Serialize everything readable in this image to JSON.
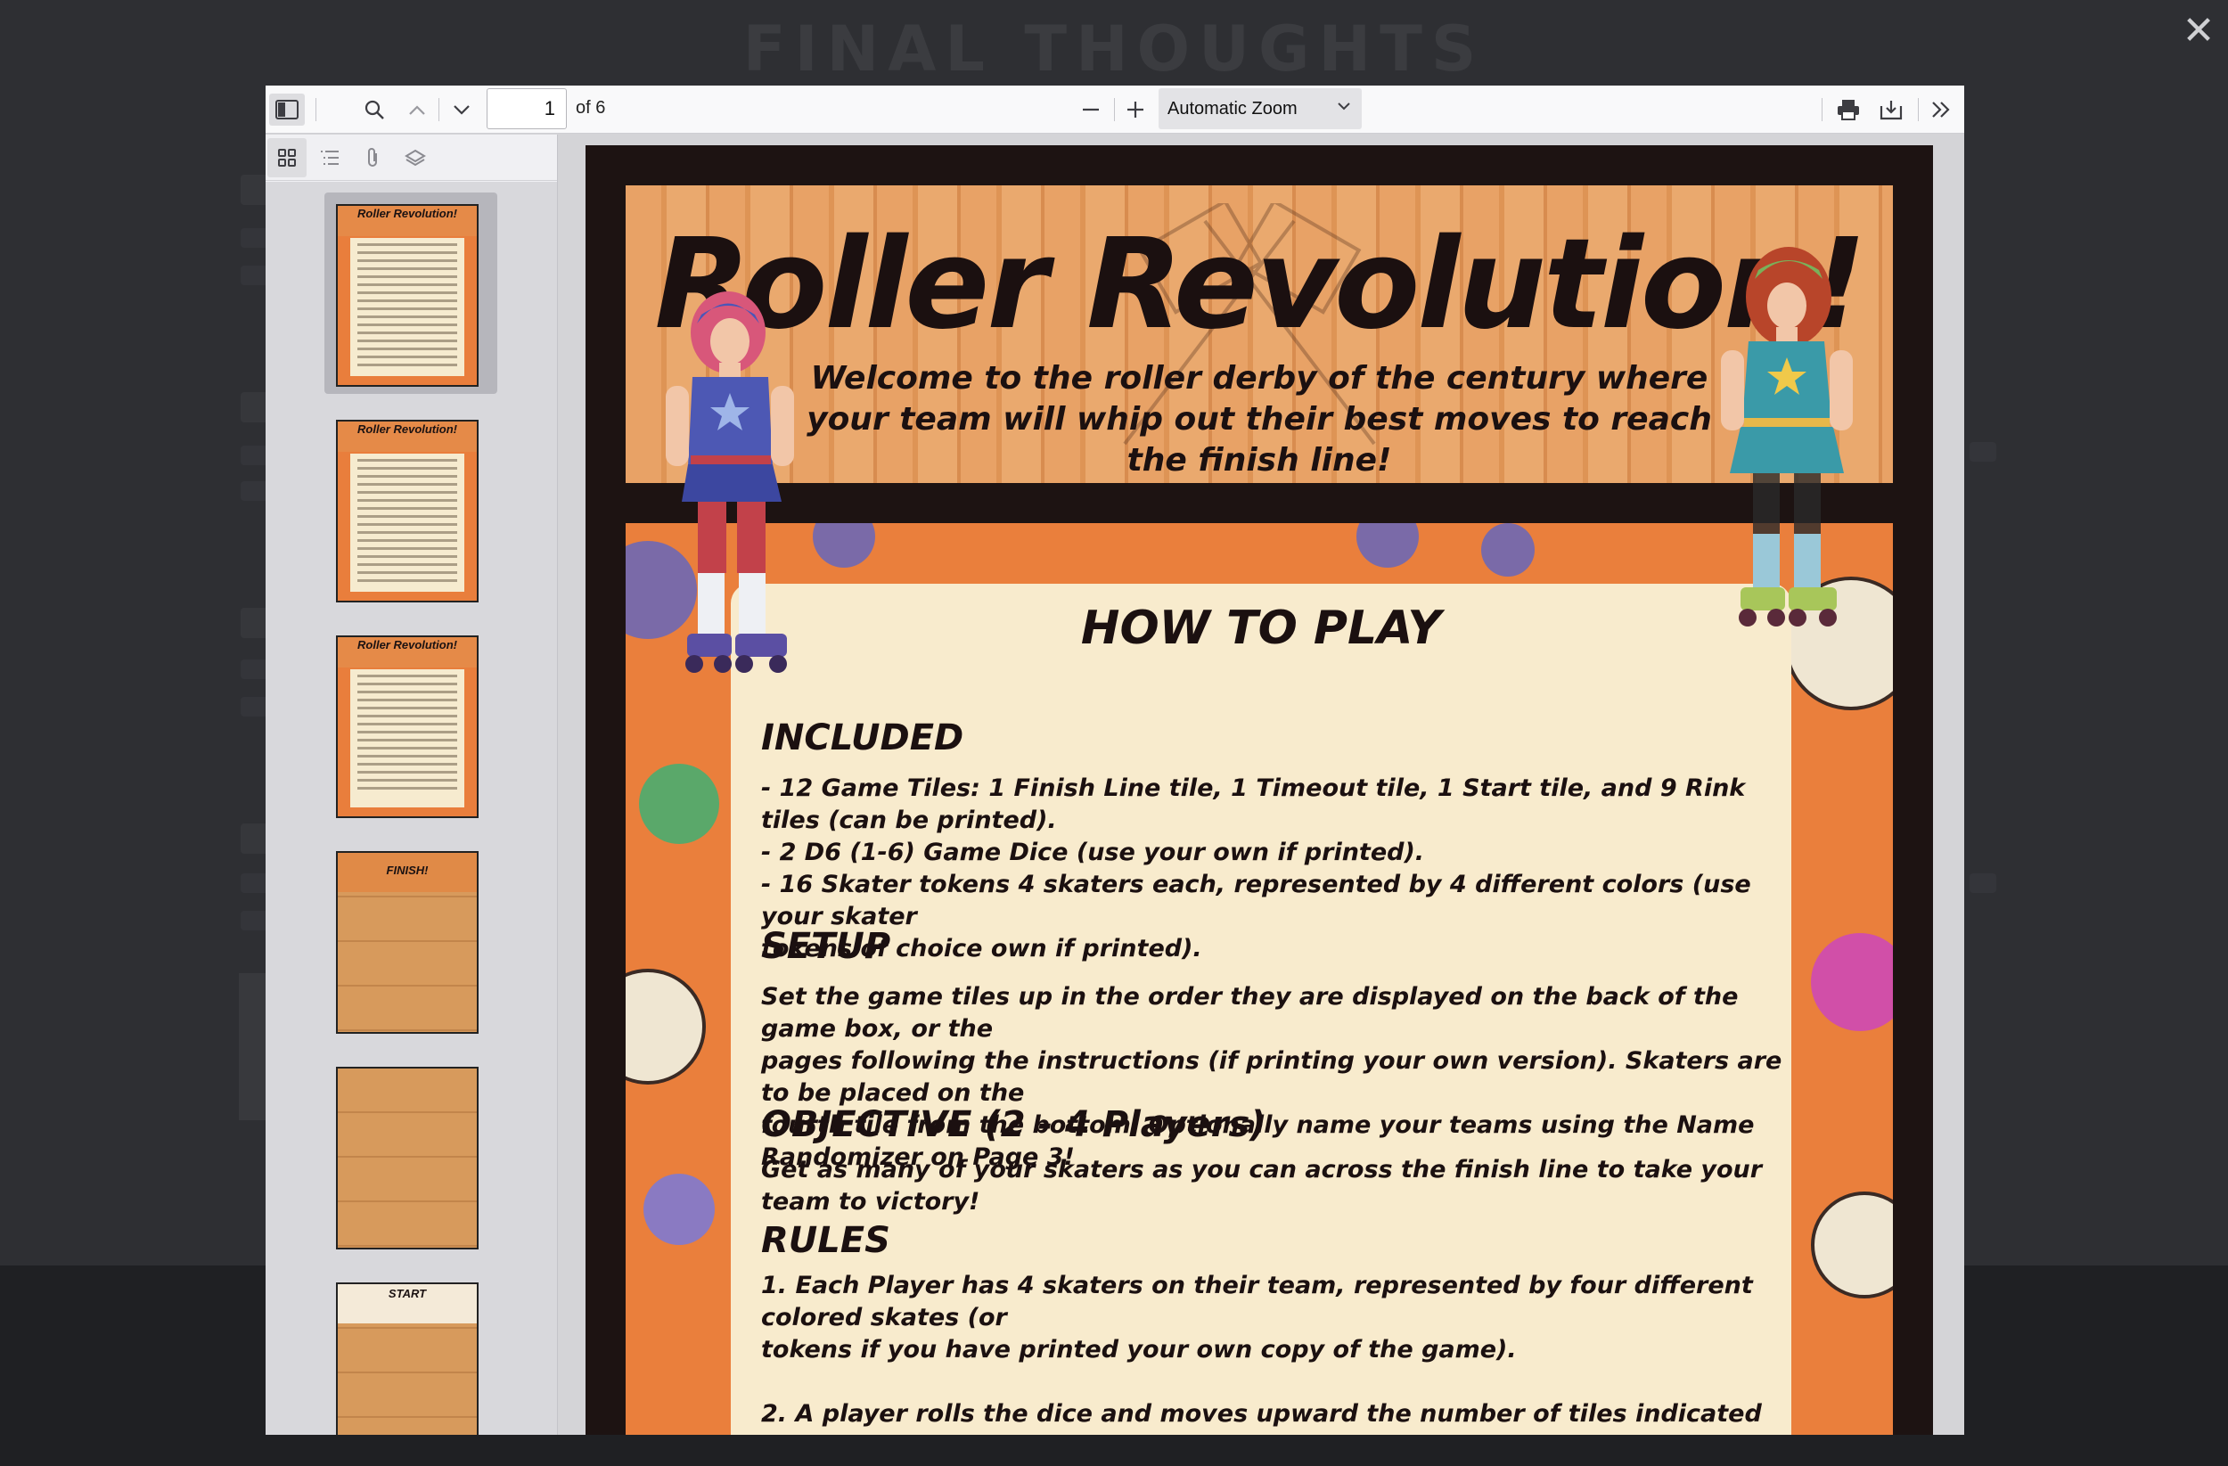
{
  "background": {
    "heading": "FINAL THOUGHTS"
  },
  "toolbar": {
    "page_number": "1",
    "page_count": "of 6",
    "zoom": "Automatic Zoom"
  },
  "document": {
    "title": "Roller Revolution!",
    "subtitle": "Welcome to the roller derby of the century where your team will whip out their best moves to reach the finish line!",
    "section_title": "HOW TO PLAY",
    "included_heading": "INCLUDED",
    "included_text": "- 12 Game Tiles: 1 Finish Line tile, 1 Timeout tile, 1 Start tile, and 9 Rink tiles (can be printed).\n- 2 D6 (1-6) Game Dice (use your own if printed).\n- 16 Skater tokens 4 skaters each, represented by 4 different colors (use your skater\n   tokens of choice own if printed).",
    "setup_heading": "SETUP",
    "setup_text": "Set the game tiles up in the order they are displayed on the back of the game box, or the\npages following the instructions (if printing your own version). Skaters are to be placed on the\nfourth tile from the bottom. Optionally name your teams using the Name Randomizer on Page 3!",
    "objective_heading": "OBJECTIVE (2 - 4 Players)",
    "objective_text": "Get as many of your skaters as you can across the finish line to take your team to victory!",
    "rules_heading": "RULES",
    "rules_text": "1. Each Player has 4 skaters on their team, represented by four different colored skates (or\ntokens if you have printed your own copy of the game).\n\n2. A player rolls the dice and moves upward the number of tiles indicated by the number\non the dice."
  },
  "thumbnails": [
    {
      "label": "Roller Revolution!",
      "kind": "doc"
    },
    {
      "label": "Roller Revolution!",
      "kind": "doc"
    },
    {
      "label": "Roller Revolution!",
      "kind": "doc"
    },
    {
      "label": "FINISH!",
      "kind": "tile"
    },
    {
      "label": "",
      "kind": "tile"
    },
    {
      "label": "START",
      "kind": "tile"
    }
  ],
  "colors": {
    "accent_orange": "#ea7f3c",
    "card_cream": "#f8ebcd",
    "ink": "#1b1010"
  }
}
